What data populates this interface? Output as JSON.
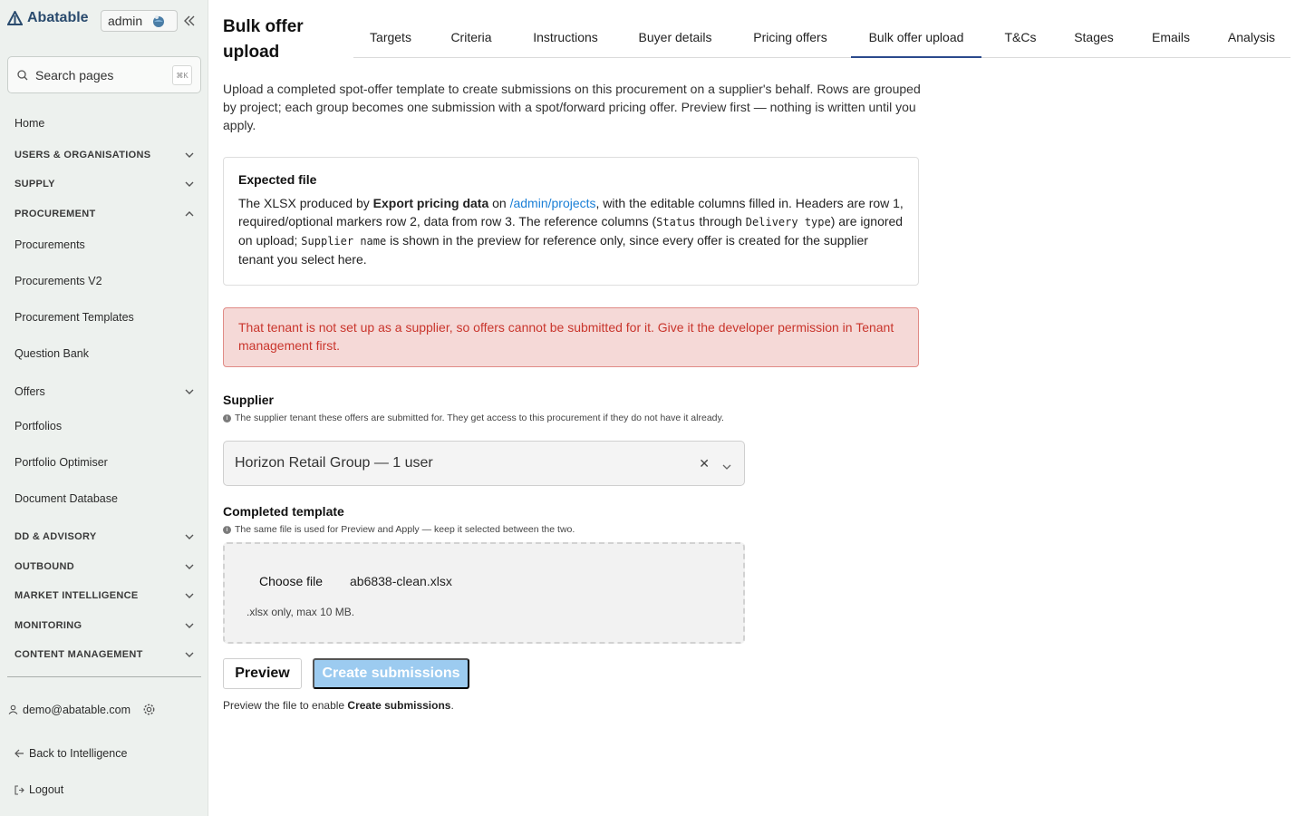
{
  "sidebar": {
    "brand": "Abatable",
    "env_label": "admin",
    "search": {
      "label": "Search pages",
      "shortcut": "⌘K"
    },
    "home": "Home",
    "sections": {
      "users": "USERS & ORGANISATIONS",
      "supply": "SUPPLY",
      "procurement": "PROCUREMENT",
      "dd": "DD & ADVISORY",
      "outbound": "OUTBOUND",
      "market": "MARKET INTELLIGENCE",
      "monitoring": "MONITORING",
      "content": "CONTENT MANAGEMENT"
    },
    "items": {
      "procurements": "Procurements",
      "procurements_v2": "Procurements V2",
      "templates": "Procurement Templates",
      "question_bank": "Question Bank",
      "offers": "Offers",
      "portfolios": "Portfolios",
      "portfolio_optimiser": "Portfolio Optimiser",
      "document_database": "Document Database"
    },
    "user_email": "demo@abatable.com",
    "back_link": "Back to Intelligence",
    "logout": "Logout"
  },
  "main": {
    "title": "Bulk offer upload",
    "tabs": [
      "Targets",
      "Criteria",
      "Instructions",
      "Buyer details",
      "Pricing offers",
      "Bulk offer upload",
      "T&Cs",
      "Stages",
      "Emails",
      "Analysis"
    ],
    "active_tab": "Bulk offer upload",
    "intro": "Upload a completed spot-offer template to create submissions on this procurement on a supplier's behalf. Rows are grouped by project; each group becomes one submission with a spot/forward pricing offer. Preview first — nothing is written until you apply.",
    "expected_file": {
      "heading": "Expected file",
      "t1": "The XLSX produced by ",
      "t2": "Export pricing data",
      "t3": " on ",
      "link": "/admin/projects",
      "t4": ", with the editable columns filled in. Headers are row 1, required/optional markers row 2, data from row 3. The reference columns (",
      "code1": "Status",
      "t5": " through ",
      "code2": "Delivery type",
      "t6": ") are ignored on upload; ",
      "code3": "Supplier name",
      "t7": " is shown in the preview for reference only, since every offer is created for the supplier tenant you select here."
    },
    "alert": "That tenant is not set up as a supplier, so offers cannot be submitted for it. Give it the developer permission in Tenant management first.",
    "supplier": {
      "label": "Supplier",
      "help": "The supplier tenant these offers are submitted for. They get access to this procurement if they do not have it already.",
      "value": "Horizon Retail Group — 1 user"
    },
    "template": {
      "label": "Completed template",
      "help": "The same file is used for Preview and Apply — keep it selected between the two.",
      "choose_label": "Choose file",
      "file_name": "ab6838-clean.xlsx",
      "limit": ".xlsx only, max 10 MB."
    },
    "buttons": {
      "preview": "Preview",
      "create": "Create submissions"
    },
    "note": {
      "prefix": "Preview the file to enable ",
      "bold": "Create submissions",
      "suffix": "."
    }
  },
  "colors": {
    "accent": "#2b4a8c",
    "link": "#1a7fd6",
    "alert_bg": "#f5d9d7",
    "alert_text": "#c9352c",
    "disabled_button": "#9ccbf0",
    "sidebar_bg": "#edf1ee"
  }
}
